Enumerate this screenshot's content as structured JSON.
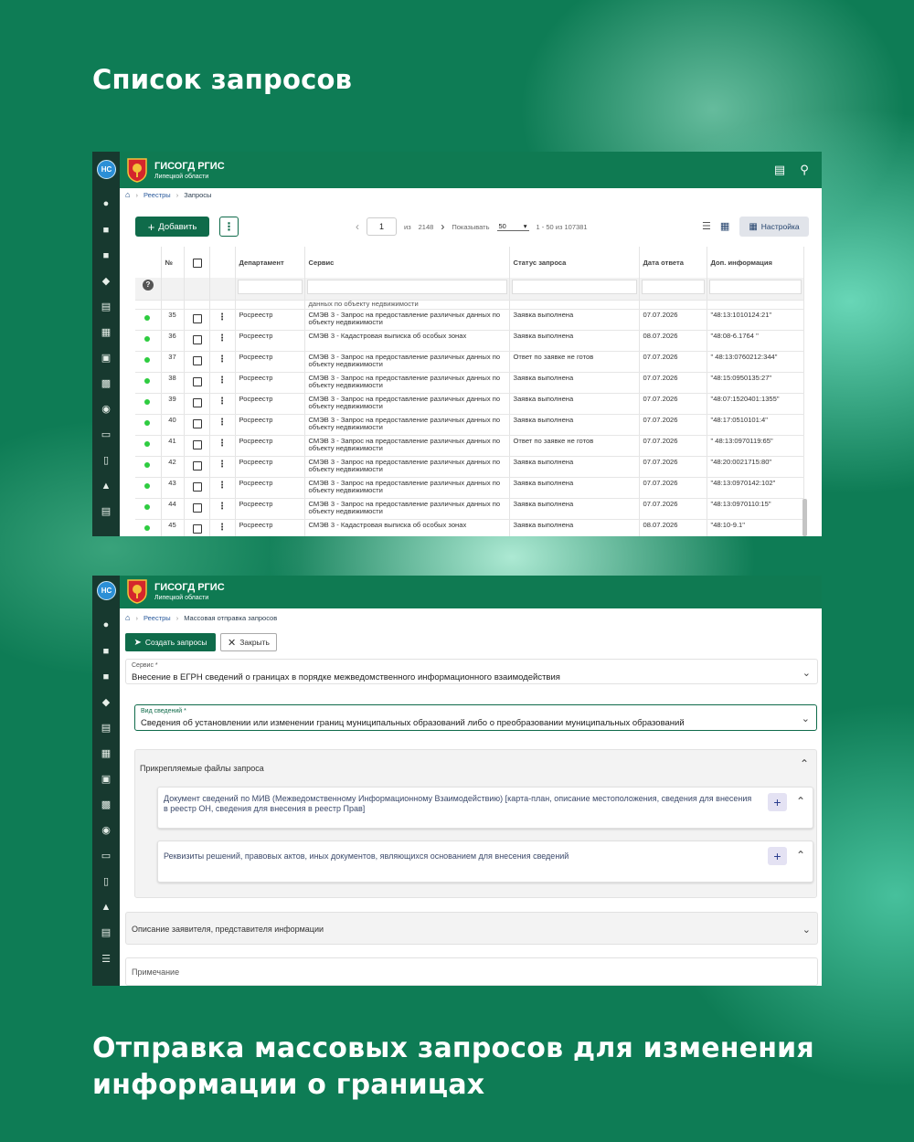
{
  "headings": {
    "top": "Список запросов",
    "bottom": "Отправка массовых запросов для изменения информации о границах"
  },
  "app": {
    "avatar": "НС",
    "title": "ГИСОГД РГИС",
    "subtitle": "Липецкой области",
    "accent": "#0f7a52",
    "rail_color": "#17392f"
  },
  "shot1": {
    "breadcrumbs": [
      "Реестры",
      "Запросы"
    ],
    "add_label": "Добавить",
    "pager": {
      "page": "1",
      "of_label": "из",
      "total_pages": "2148",
      "show_label": "Показывать",
      "page_size": "50",
      "range": "1 - 50 из 107381"
    },
    "settings_label": "Настройка",
    "columns": {
      "num": "№",
      "dept": "Департамент",
      "service": "Сервис",
      "status": "Статус запроса",
      "date": "Дата ответа",
      "info": "Доп. информация"
    },
    "partial_row_text": "данных по объекту недвижимости",
    "rows": [
      {
        "num": "35",
        "dept": "Росреестр",
        "service": "СМЭВ 3 - Запрос на предоставление различных данных по объекту недвижимости",
        "status": "Заявка выполнена",
        "date": "07.07.2026",
        "info": "\"48:13:1010124:21\""
      },
      {
        "num": "36",
        "dept": "Росреестр",
        "service": "СМЭВ 3 - Кадастровая выписка об особых зонах",
        "status": "Заявка выполнена",
        "date": "08.07.2026",
        "info": "\"48:08-6.1764 \""
      },
      {
        "num": "37",
        "dept": "Росреестр",
        "service": "СМЭВ 3 - Запрос на предоставление различных данных по объекту недвижимости",
        "status": "Ответ по заявке не готов",
        "date": "07.07.2026",
        "info": "\" 48:13:0760212:344\""
      },
      {
        "num": "38",
        "dept": "Росреестр",
        "service": "СМЭВ 3 - Запрос на предоставление различных данных по объекту недвижимости",
        "status": "Заявка выполнена",
        "date": "07.07.2026",
        "info": "\"48:15:0950135:27\""
      },
      {
        "num": "39",
        "dept": "Росреестр",
        "service": "СМЭВ 3 - Запрос на предоставление различных данных по объекту недвижимости",
        "status": "Заявка выполнена",
        "date": "07.07.2026",
        "info": "\"48:07:1520401:1355\""
      },
      {
        "num": "40",
        "dept": "Росреестр",
        "service": "СМЭВ 3 - Запрос на предоставление различных данных по объекту недвижимости",
        "status": "Заявка выполнена",
        "date": "07.07.2026",
        "info": "\"48:17:0510101:4\""
      },
      {
        "num": "41",
        "dept": "Росреестр",
        "service": "СМЭВ 3 - Запрос на предоставление различных данных по объекту недвижимости",
        "status": "Ответ по заявке не готов",
        "date": "07.07.2026",
        "info": "\" 48:13:0970119:65\""
      },
      {
        "num": "42",
        "dept": "Росреестр",
        "service": "СМЭВ 3 - Запрос на предоставление различных данных по объекту недвижимости",
        "status": "Заявка выполнена",
        "date": "07.07.2026",
        "info": "\"48:20:0021715:80\""
      },
      {
        "num": "43",
        "dept": "Росреестр",
        "service": "СМЭВ 3 - Запрос на предоставление различных данных по объекту недвижимости",
        "status": "Заявка выполнена",
        "date": "07.07.2026",
        "info": "\"48:13:0970142:102\""
      },
      {
        "num": "44",
        "dept": "Росреестр",
        "service": "СМЭВ 3 - Запрос на предоставление различных данных по объекту недвижимости",
        "status": "Заявка выполнена",
        "date": "07.07.2026",
        "info": "\"48:13:0970110:15\""
      },
      {
        "num": "45",
        "dept": "Росреестр",
        "service": "СМЭВ 3 - Кадастровая выписка об особых зонах",
        "status": "Заявка выполнена",
        "date": "08.07.2026",
        "info": "\"48:10-9.1\""
      }
    ]
  },
  "shot2": {
    "breadcrumbs": [
      "Реестры",
      "Массовая отправка запросов"
    ],
    "create_label": "Создать запросы",
    "close_label": "Закрыть",
    "service": {
      "label": "Сервис *",
      "value": "Внесение в ЕГРН сведений о границах в порядке межведомственного информационного взаимодействия"
    },
    "info_kind": {
      "label": "Вид сведений *",
      "value": "Сведения об установлении или изменении границ муниципальных образований либо о преобразовании муниципальных образований"
    },
    "attachments_title": "Прикрепляемые файлы запроса",
    "attachments": [
      "Документ сведений по МИВ (Межведомственному Информационному Взаимодействию) [карта-план, описание местоположения, сведения для внесения в реестр ОН, сведения для внесения в реестр Прав]",
      "Реквизиты решений, правовых актов, иных документов, являющихся основанием для внесения сведений"
    ],
    "applicant_title": "Описание заявителя, представителя информации",
    "note_placeholder": "Примечание"
  }
}
